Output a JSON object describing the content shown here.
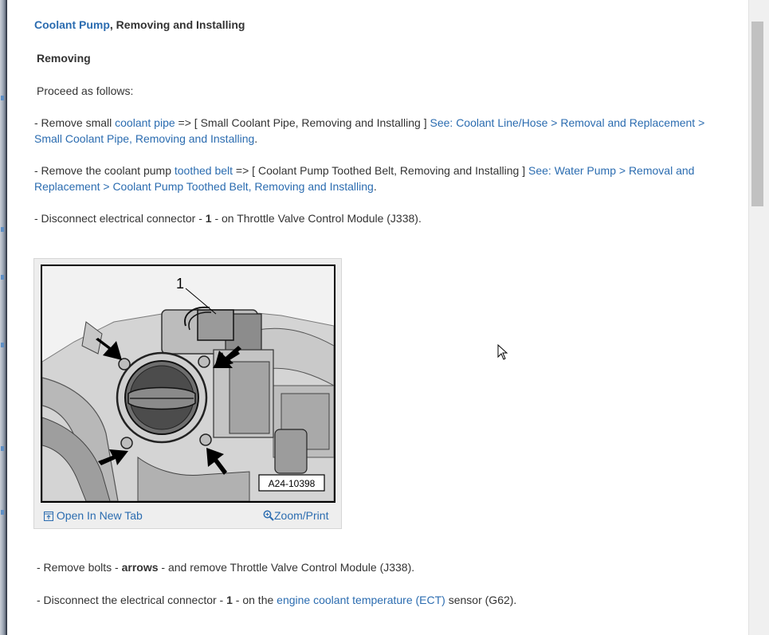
{
  "title": {
    "link": "Coolant Pump",
    "rest": ", Removing and Installing"
  },
  "section_heading": "Removing",
  "intro": "Proceed as follows:",
  "steps": [
    {
      "prefix": "-  Remove small ",
      "link": "coolant pipe",
      "middle": " => [ Small Coolant Pipe, Removing and Installing ] ",
      "see_link": "See: Coolant Line/Hose > Removal and Replacement > Small Coolant Pipe, Removing and Installing",
      "suffix": "."
    },
    {
      "prefix": "-  Remove the coolant pump ",
      "link": "toothed belt",
      "middle": " => [ Coolant Pump Toothed Belt, Removing and Installing ] ",
      "see_link": "See: Water Pump > Removal and Replacement > Coolant Pump Toothed Belt, Removing and Installing",
      "suffix": "."
    },
    {
      "prefix": "-  Disconnect electrical connector - ",
      "bold": "1",
      "suffix": " - on Throttle Valve Control Module (J338)."
    },
    {
      "prefix": "-  Remove bolts - ",
      "bold": "arrows",
      "suffix": " - and remove Throttle Valve Control Module (J338)."
    },
    {
      "prefix": "-  Disconnect the electrical connector - ",
      "bold": "1",
      "middle": " - on the ",
      "link": "engine coolant temperature (ECT)",
      "suffix": " sensor (G62)."
    }
  ],
  "figure": {
    "callout": "1",
    "ref_code": "A24-10398",
    "open_label": "Open In New Tab",
    "zoom_label": "Zoom/Print"
  }
}
